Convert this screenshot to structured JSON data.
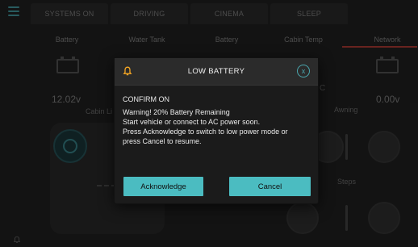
{
  "colors": {
    "accent": "#4bbcc1",
    "alert": "#f5a623",
    "network_underline": "#c0403a",
    "background": "#242424",
    "modal_bg": "#1b1b1b"
  },
  "icons": {
    "menu": "hamburger-icon",
    "bell": "bell-icon",
    "close": "close-circle-icon",
    "battery": "battery-icon",
    "power": "power-icon"
  },
  "top_tabs": [
    "SYSTEMS ON",
    "DRIVING",
    "CINEMA",
    "SLEEP"
  ],
  "columns": [
    "Battery",
    "Water Tank",
    "Battery",
    "Cabin Temp",
    "Network"
  ],
  "voltages": {
    "left": "12.02v",
    "right": "0.00v"
  },
  "labels": {
    "cabin_lights": "Cabin Li",
    "awning": "Awning",
    "steps": "Steps",
    "temp_suffix": "C"
  },
  "modal": {
    "title": "LOW BATTERY",
    "close_symbol": "x",
    "heading": "CONFIRM ON",
    "lines": [
      "Warning! 20% Battery Remaining",
      "Start vehicle or connect to AC power soon.",
      "Press Acknowledge to switch to low power mode or",
      "press Cancel to resume."
    ],
    "acknowledge_label": "Acknowledge",
    "cancel_label": "Cancel"
  }
}
